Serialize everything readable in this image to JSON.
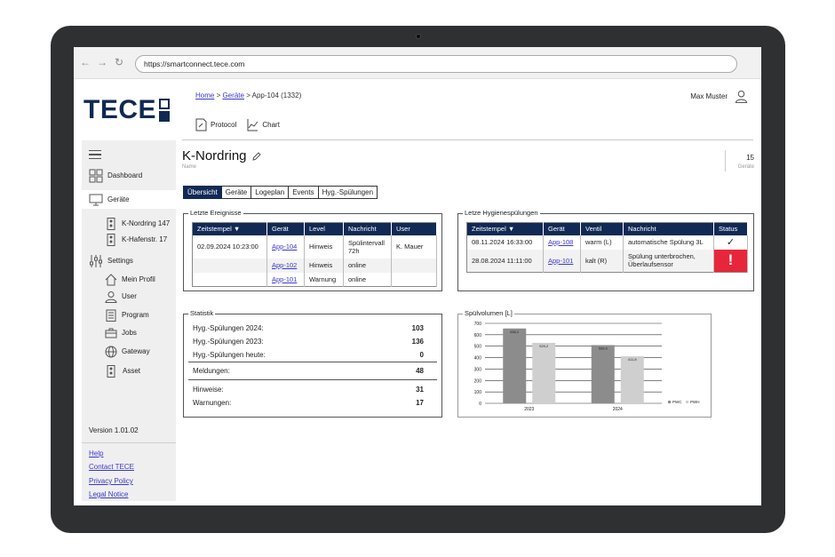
{
  "browser": {
    "url": "https://smartconnect.tece.com",
    "back": "←",
    "forward": "→",
    "reload": "↻"
  },
  "logo": {
    "text": "TECE"
  },
  "breadcrumb": {
    "home": "Home",
    "sep1": ">",
    "devices": "Geräte",
    "sep2": ">",
    "current": "App-104 (1332)"
  },
  "user": {
    "name": "Max Muster"
  },
  "toolbar": {
    "protocol": "Protocol",
    "chart": "Chart"
  },
  "sidebar": {
    "items": [
      {
        "label": "Dashboard",
        "icon": "dashboard-icon"
      },
      {
        "label": "Geräte",
        "icon": "devices-icon"
      },
      {
        "label": "K-Nordring 147",
        "icon": "device-icon"
      },
      {
        "label": "K-Hafenstr. 17",
        "icon": "device-icon"
      },
      {
        "label": "Settings",
        "icon": "settings-icon"
      },
      {
        "label": "Mein Profil",
        "icon": "home-icon"
      },
      {
        "label": "User",
        "icon": "user-icon"
      },
      {
        "label": "Program",
        "icon": "program-icon"
      },
      {
        "label": "Jobs",
        "icon": "briefcase-icon"
      },
      {
        "label": "Gateway",
        "icon": "globe-icon"
      },
      {
        "label": "Asset",
        "icon": "device-icon"
      }
    ],
    "version": "Version 1.01.02",
    "links": [
      "Help",
      "Contact TECE",
      "Privacy Policy",
      "Legal Notice"
    ]
  },
  "page": {
    "title": "K-Nordring",
    "subtitle": "Name",
    "count": "15",
    "count_label": "Geräte"
  },
  "tabs": [
    "Übersicht",
    "Geräte",
    "Logeplan",
    "Events",
    "Hyg.-Spülungen"
  ],
  "events": {
    "label": "Letzte Ereignisse",
    "headers": [
      "Zeitstempel ▼",
      "Gerät",
      "Level",
      "Nachricht",
      "User"
    ],
    "rows": [
      {
        "time": "02.09.2024  10:23:00",
        "device": "App-104",
        "level": "Hinweis",
        "message": "Spülintervall 72h",
        "user": "K. Mauer"
      },
      {
        "time": "",
        "device": "App-102",
        "level": "Hinweis",
        "message": "online",
        "user": ""
      },
      {
        "time": "",
        "device": "App-101",
        "level": "Warnung",
        "message": "online",
        "user": ""
      }
    ]
  },
  "hygiene": {
    "label": "Letze Hygienespülungen",
    "headers": [
      "Zeitstempel ▼",
      "Gerät",
      "Ventil",
      "Nachricht",
      "Status"
    ],
    "rows": [
      {
        "time": "08.11.2024  16:33:00",
        "device": "App-108",
        "valve": "warm (L)",
        "message": "automatische Spülung 3L",
        "status": "✓"
      },
      {
        "time": "28.08.2024  11:11:00",
        "device": "App-101",
        "valve": "kalt (R)",
        "message": "Spülung unterbrochen, Überlaufsensor",
        "status": "!"
      }
    ],
    "error_color": "#e8263a"
  },
  "stats": {
    "label": "Statistik",
    "rows": [
      {
        "label": "Hyg.-Spülungen 2024:",
        "value": "103"
      },
      {
        "label": "Hyg.-Spülungen 2023:",
        "value": "136"
      },
      {
        "label": "Hyg.-Spülungen heute:",
        "value": "0"
      },
      {
        "label": "Meldungen:",
        "value": "48"
      },
      {
        "label": "Hinweise:",
        "value": "31"
      },
      {
        "label": "Warnungen:",
        "value": "17"
      }
    ]
  },
  "chart_data": {
    "type": "bar",
    "title": "Spülvolumen [L]",
    "categories": [
      "2023",
      "2024"
    ],
    "series": [
      {
        "name": "PWC",
        "values": [
          655.2,
          509.6
        ],
        "labels": [
          "655,2",
          "509,6"
        ],
        "color": "#8c8c8c"
      },
      {
        "name": "PWH",
        "values": [
          529.2,
          411.8
        ],
        "labels": [
          "529,2",
          "411,8"
        ],
        "color": "#cfcfcf"
      }
    ],
    "ylim": [
      0,
      700
    ],
    "yticks": [
      0,
      100,
      200,
      300,
      400,
      500,
      600,
      700
    ],
    "grid": true,
    "legend": "bottom-right"
  },
  "colors": {
    "brand": "#102a55",
    "link": "#3a3acc"
  }
}
